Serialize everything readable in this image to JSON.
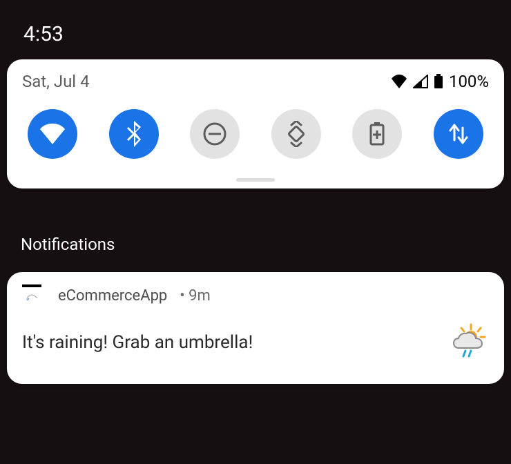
{
  "status_bar": {
    "clock": "4:53"
  },
  "qs": {
    "date": "Sat, Jul 4",
    "battery_pct": "100%",
    "tiles": [
      {
        "name": "wifi",
        "on": true
      },
      {
        "name": "bluetooth",
        "on": true
      },
      {
        "name": "dnd",
        "on": false
      },
      {
        "name": "autorotate",
        "on": false
      },
      {
        "name": "battery",
        "on": false
      },
      {
        "name": "data",
        "on": true
      }
    ]
  },
  "notifications": {
    "section_label": "Notifications",
    "items": [
      {
        "app_name": "eCommerceApp",
        "time": "9m",
        "body": "It's raining! Grab an umbrella!",
        "image_desc": "weather-sun-rain"
      }
    ]
  }
}
